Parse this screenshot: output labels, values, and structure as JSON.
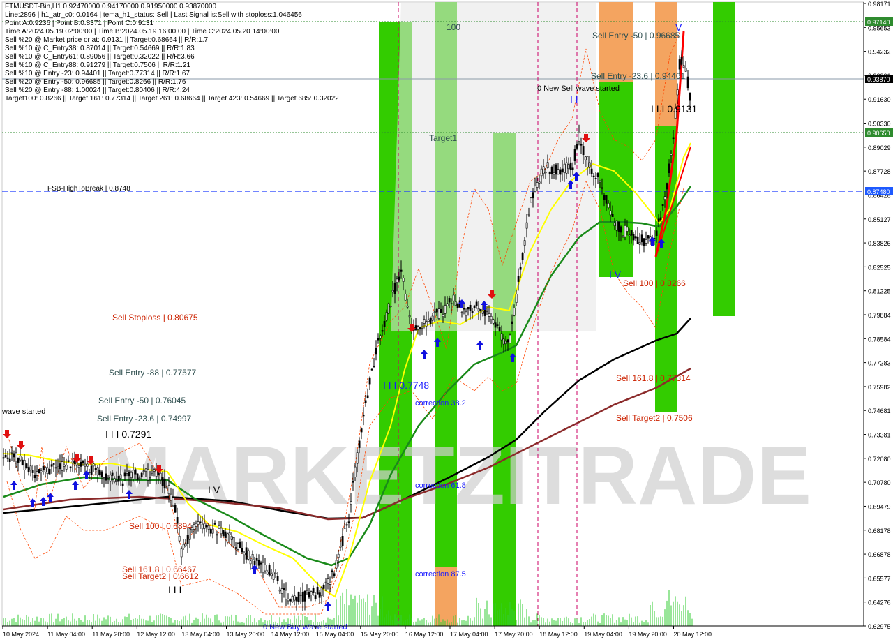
{
  "info_lines": [
    "FTMUSDT-Bin,H1  0.92470000 0.94170000 0.91950000 0.93870000",
    "Line:2896 | h1_atr_c0: 0.0164 | tema_h1_status: Sell | Last Signal is:Sell with stoploss:1.046456",
    "Point A:0.9236 | Point B:0.8371 | Point C:0.9131",
    "Time A:2024.05.19 02:00:00 | Time B:2024.05.19 16:00:00 | Time C:2024.05.20 14:00:00",
    "Sell %20 @ Market price or at: 0.9131 || Target:0.68664 || R/R:1.7",
    "Sell %10 @ C_Entry38: 0.87014 || Target:0.54669 || R/R:1.83",
    "Sell %10 @ C_Entry61: 0.89056 || Target:0.32022 || R/R:3.66",
    "Sell %10 @ C_Entry88: 0.91279 || Target:0.7506 || R/R:1.21",
    "Sell %10 @ Entry -23: 0.94401 || Target:0.77314 || R/R:1.67",
    "Sell %20 @ Entry -50: 0.96685 || Target:0.8266 || R/R:1.76",
    "Sell %20 @ Entry -88: 1.00024 || Target:0.80406 || R/R:4.24",
    "Target100: 0.8266 || Target 161: 0.77314 || Target 261: 0.68664 || Target 423: 0.54669 || Target 685: 0.32022"
  ],
  "price_axis": [
    "0.98171",
    "0.95653",
    "0.94232",
    "0.92931",
    "0.91630",
    "0.90330",
    "0.89029",
    "0.87728",
    "0.86428",
    "0.85127",
    "0.83826",
    "0.82525",
    "0.81225",
    "0.79884",
    "0.78584",
    "0.77283",
    "0.75982",
    "0.74681",
    "0.73381",
    "0.72080",
    "0.70780",
    "0.69479",
    "0.68178",
    "0.66878",
    "0.65577",
    "0.64276",
    "0.62975"
  ],
  "price_tags": [
    {
      "text": "0.97140",
      "color": "#2e8b2e"
    },
    {
      "text": "0.93870",
      "color": "#000000"
    },
    {
      "text": "0.90650",
      "color": "#2e8b2e"
    },
    {
      "text": "0.87480",
      "color": "#1e5aff"
    }
  ],
  "time_axis": [
    "10 May 2024",
    "11 May 04:00",
    "11 May 20:00",
    "12 May 12:00",
    "13 May 04:00",
    "13 May 20:00",
    "14 May 12:00",
    "15 May 04:00",
    "15 May 20:00",
    "16 May 12:00",
    "17 May 04:00",
    "17 May 20:00",
    "18 May 12:00",
    "19 May 04:00",
    "19 May 20:00",
    "20 May 12:00"
  ],
  "watermark": "MARKETZITRADE",
  "labels": {
    "fsb": "FSB-HighToBreak  |  0.8748",
    "sell_stoploss": "Sell Stoploss | 0.80675",
    "sell_entry_88": "Sell Entry -88 | 0.77577",
    "sell_entry_50_left": "Sell Entry -50 | 0.76045",
    "sell_entry_236_left": "Sell Entry -23.6 | 0.74997",
    "iii_7291": "I I I 0.7291",
    "iv_left": "I V",
    "sell_100_left": "Sell 100 | 0.6894",
    "sell_1618_left": "Sell 161.8 | 0.66467",
    "sell_target2_left": "Sell Target2 | 0.6612",
    "iii_bottom": "I I I",
    "wave_started": "wave started",
    "new_buy_wave": "0 New Buy Wave started",
    "iii_7748": "I I I 0.7748",
    "correction_382": "correction 38.2",
    "correction_618": "correction 61.8",
    "correction_875": "correction 87.5",
    "n100": "100",
    "target1": "Target1",
    "new_sell_wave": "0 New Sell wave started",
    "sell_entry_50_right": "Sell Entry -50 | 0.96685",
    "sell_entry_236_right": "Sell Entry -23.6 | 0.94401",
    "iii_9131": "I I I 0.9131",
    "iv_right": "I V",
    "sell_100_right": "Sell 100 | 0.8266",
    "sell_1618_right": "Sell 161.8 | 0.77314",
    "sell_target2_right": "Sell Target2 | 0.7506",
    "v_top": "V",
    "i_ii_top": "I  I"
  },
  "colors": {
    "green_zone": "#33cc00",
    "orange_zone": "#f4a460",
    "sell_red": "#b22222",
    "buy_blue": "#0000ff",
    "ma_black": "#000000",
    "ma_darkred": "#8b2a2a",
    "ma_green": "#1a8a1a",
    "ma_yellow": "#ffff00",
    "zigzag_red": "#ff0000"
  }
}
